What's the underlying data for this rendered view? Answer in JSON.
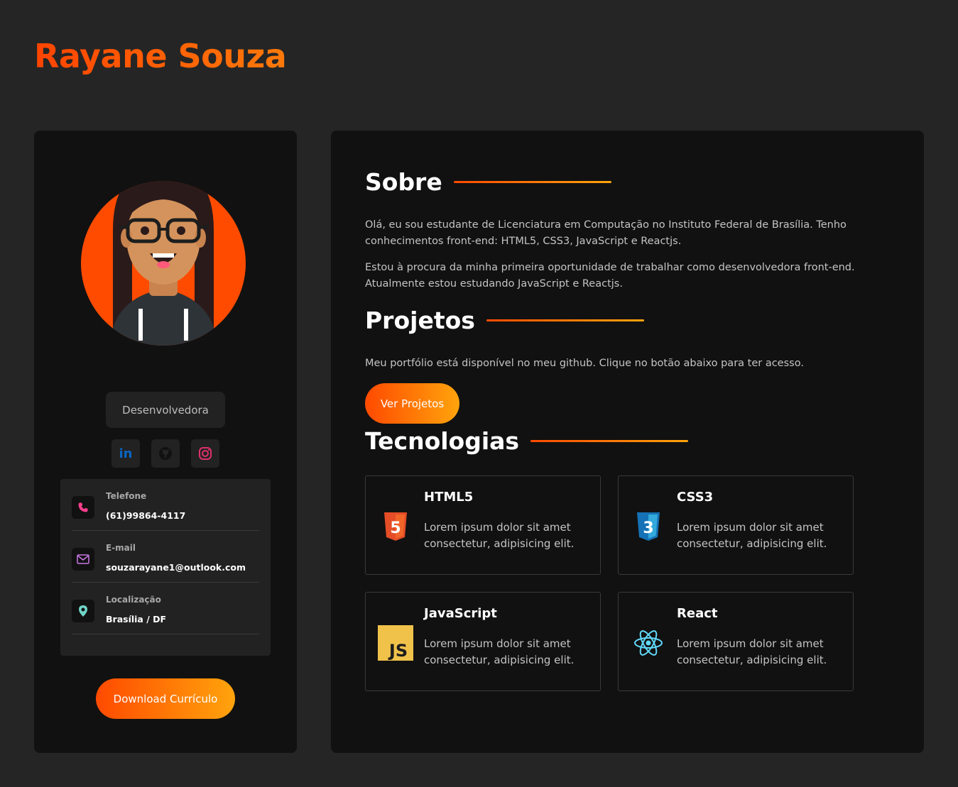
{
  "header": {
    "name": "Rayane Souza"
  },
  "profile": {
    "role": "Desenvolvedora",
    "socials": [
      {
        "icon": "linkedin-icon",
        "label": "in"
      },
      {
        "icon": "github-icon"
      },
      {
        "icon": "instagram-icon"
      }
    ],
    "contacts": [
      {
        "label": "Telefone",
        "value": "(61)99864-4117",
        "icon": "phone-icon"
      },
      {
        "label": "E-mail",
        "value": "souzarayane1@outlook.com",
        "icon": "mail-icon"
      },
      {
        "label": "Localização",
        "value": "Brasília / DF",
        "icon": "location-icon"
      }
    ],
    "download_label": "Download Currículo"
  },
  "main": {
    "about": {
      "title": "Sobre",
      "p1": "Olá, eu sou estudante de Licenciatura em Computação no Instituto Federal de Brasília. Tenho conhecimentos front-end: HTML5, CSS3, JavaScript e Reactjs.",
      "p2": "Estou à procura da minha primeira oportunidade de trabalhar como desenvolvedora front-end. Atualmente estou estudando JavaScript e Reactjs."
    },
    "projects": {
      "title": "Projetos",
      "text": "Meu portfólio está disponível no meu github. Clique no botão abaixo para ter acesso.",
      "button_label": "Ver Projetos"
    },
    "tech": {
      "title": "Tecnologias",
      "items": [
        {
          "name": "HTML5",
          "desc": "Lorem ipsum dolor sit amet consectetur, adipisicing elit.",
          "icon": "html5-icon",
          "icon_text": "5"
        },
        {
          "name": "CSS3",
          "desc": "Lorem ipsum dolor sit amet consectetur, adipisicing elit.",
          "icon": "css3-icon",
          "icon_text": "3"
        },
        {
          "name": "JavaScript",
          "desc": "Lorem ipsum dolor sit amet consectetur, adipisicing elit.",
          "icon": "javascript-icon",
          "icon_text": "JS"
        },
        {
          "name": "React",
          "desc": "Lorem ipsum dolor sit amet consectetur, adipisicing elit.",
          "icon": "react-icon"
        }
      ]
    }
  },
  "colors": {
    "accent_start": "#ff4a00",
    "accent_end": "#ffa40c",
    "linkedin": "#0a66c2",
    "instagram": "#e1306c",
    "html5": "#e44d26",
    "css3": "#1572b6",
    "javascript": "#f0c24a",
    "react": "#61dafb"
  }
}
